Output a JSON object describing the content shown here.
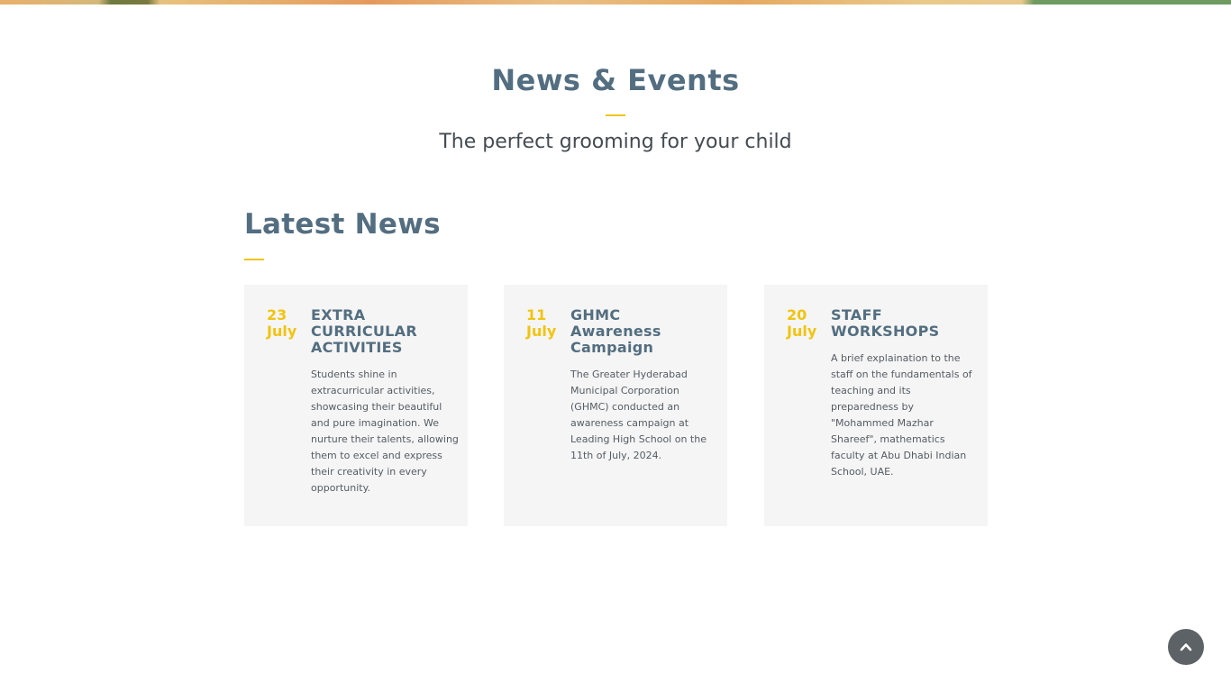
{
  "section": {
    "title": "News & Events",
    "subtitle": "The perfect grooming for your child"
  },
  "latest": {
    "title": "Latest News"
  },
  "news": [
    {
      "day": "23",
      "month": "July",
      "title": "EXTRA CURRICULAR ACTIVITIES",
      "body": "Students shine in extracurricular activities, showcasing their beautiful and pure imagination. We nurture their talents, allowing them to excel and express their creativity in every opportunity."
    },
    {
      "day": "11",
      "month": "July",
      "title": "GHMC Awareness Campaign",
      "body": "The Greater Hyderabad Municipal Corporation (GHMC) conducted an awareness campaign at Leading High School on the 11th of July, 2024."
    },
    {
      "day": "20",
      "month": "July",
      "title": "STAFF WORKSHOPS",
      "body": "A brief explaination to the staff on the fundamentals of teaching and its preparedness by \"Mohammed Mazhar Shareef\", mathematics faculty at Abu Dhabi Indian School, UAE."
    }
  ],
  "colors": {
    "accent": "#f1c40f",
    "heading": "#536e80",
    "card_bg": "#f5f5f5",
    "scroll_button": "#5d6266"
  },
  "icons": {
    "scroll_top": "chevron-up-icon"
  }
}
